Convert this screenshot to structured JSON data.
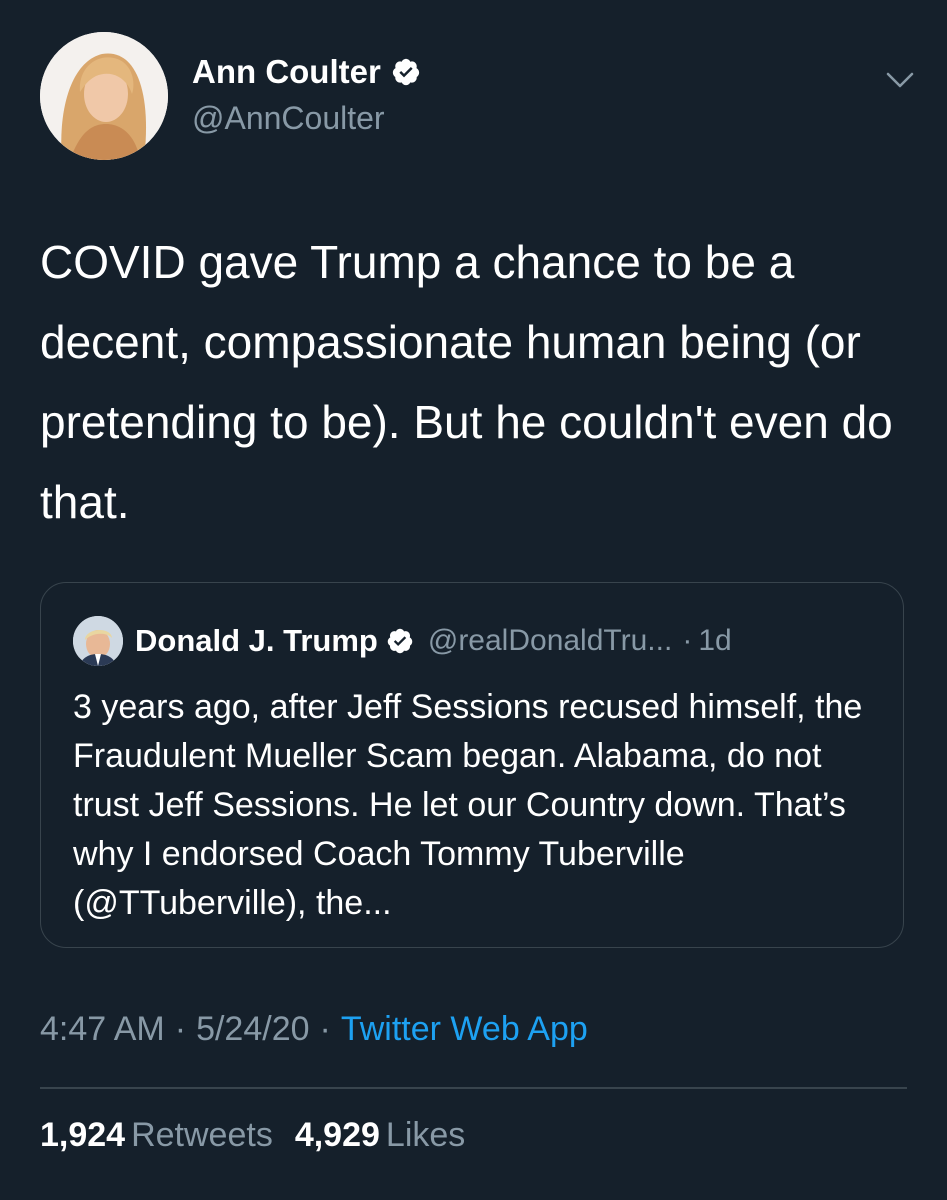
{
  "tweet": {
    "author": {
      "display_name": "Ann Coulter",
      "handle": "@AnnCoulter",
      "verified": true,
      "avatar_icon": "profile-photo"
    },
    "text": "COVID gave Trump a chance to be a decent, compassionate human being (or pretending to be). But he couldn't even do that.",
    "menu_icon": "chevron-down-icon",
    "quoted_tweet": {
      "author": {
        "display_name": "Donald J. Trump",
        "handle": "@realDonaldTru...",
        "verified": true
      },
      "separator": "·",
      "relative_time": "1d",
      "text": "3 years ago, after Jeff Sessions recused himself, the Fraudulent Mueller Scam began. Alabama, do not trust Jeff Sessions. He let our Country down. That’s why I endorsed Coach Tommy Tuberville (@TTuberville), the..."
    },
    "meta": {
      "time": "4:47 AM",
      "separator": "·",
      "date": "5/24/20",
      "source": "Twitter Web App"
    },
    "stats": {
      "retweets_count": "1,924",
      "retweets_label": "Retweets",
      "likes_count": "4,929",
      "likes_label": "Likes"
    }
  },
  "colors": {
    "background": "#15202b",
    "text_primary": "#ffffff",
    "text_secondary": "#8899a6",
    "accent": "#1da1f2",
    "border": "#38444d"
  }
}
